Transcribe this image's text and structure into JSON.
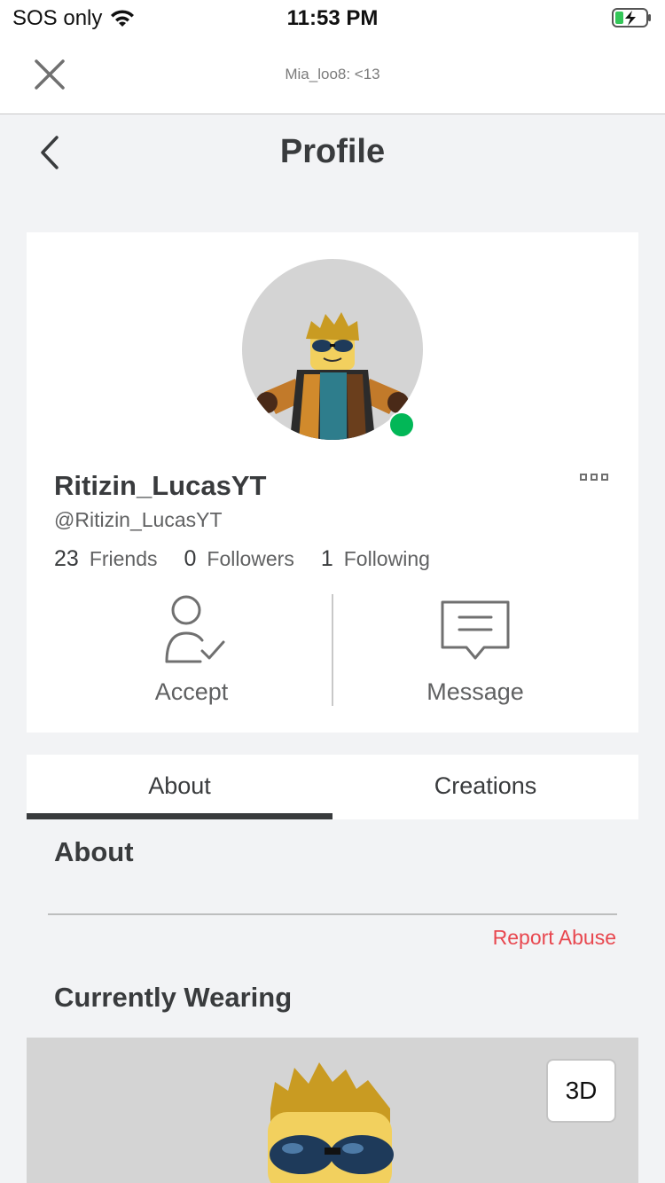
{
  "status_bar": {
    "carrier": "SOS only",
    "time": "11:53 PM",
    "wifi_icon": "wifi-icon",
    "battery_icon": "battery-charging-icon"
  },
  "browser": {
    "url_text": "Mia_loo8: <13",
    "close_icon": "close-icon"
  },
  "nav": {
    "title": "Profile",
    "back_icon": "chevron-left-icon"
  },
  "profile": {
    "display_name": "Ritizin_LucasYT",
    "username": "@Ritizin_LucasYT",
    "online": true,
    "presence_color": "#02b757",
    "stats": [
      {
        "count": "23",
        "label": "Friends"
      },
      {
        "count": "0",
        "label": "Followers"
      },
      {
        "count": "1",
        "label": "Following"
      }
    ],
    "actions": {
      "accept_label": "Accept",
      "message_label": "Message"
    }
  },
  "tabs": [
    {
      "label": "About",
      "active": true
    },
    {
      "label": "Creations",
      "active": false
    }
  ],
  "about": {
    "heading": "About",
    "report_abuse": "Report Abuse",
    "report_color": "#e8474f",
    "wearing_heading": "Currently Wearing",
    "view_3d_label": "3D"
  }
}
